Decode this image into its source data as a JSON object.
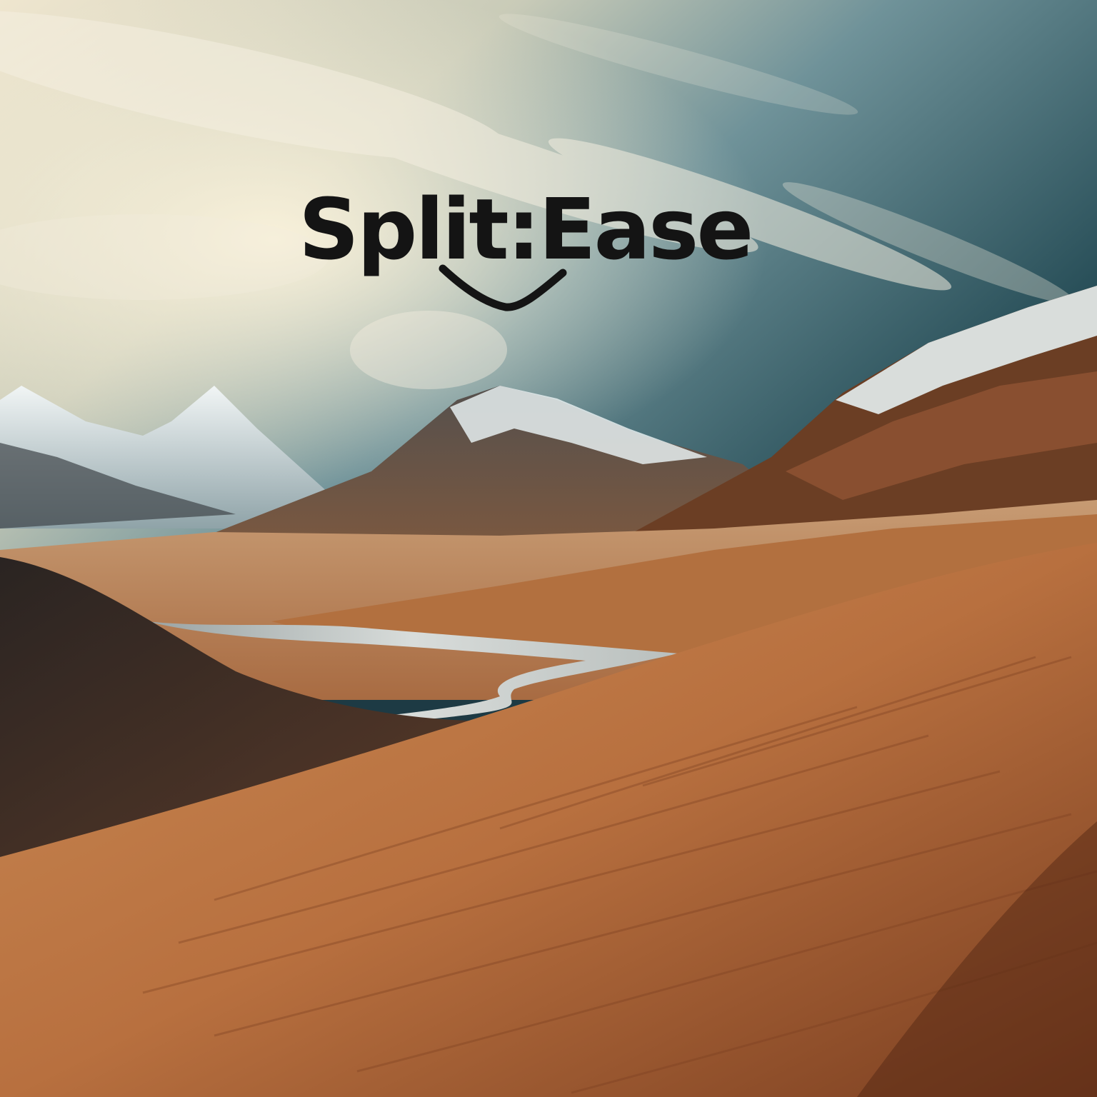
{
  "logo": {
    "text": "Split:Ease"
  },
  "colors": {
    "sky_top": "#1f4650",
    "sky_mid": "#6f9299",
    "sky_glow": "#efe6cf",
    "snow": "#e6eef0",
    "rock": "#3c3a3a",
    "sand_light": "#c98a54",
    "sand_mid": "#b8703f",
    "sand_dark": "#8a4a26",
    "water": "#c7cccb",
    "logo_ink": "#141414"
  },
  "icons": {
    "logo_mark": "smile-swoosh-icon"
  }
}
